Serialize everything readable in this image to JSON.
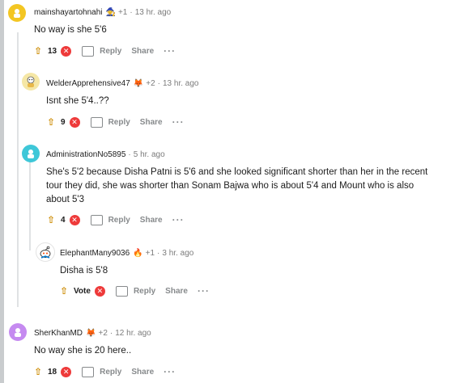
{
  "comments": [
    {
      "username": "mainshayartohnahi",
      "flair": "🧙",
      "badge": "+1",
      "time": "13 hr. ago",
      "text": "No way is she 5'6",
      "score": "13",
      "reply_label": "Reply",
      "share_label": "Share",
      "avatar_color": "#f3c623"
    },
    {
      "username": "WelderApprehensive47",
      "flair": "🦊",
      "badge": "+2",
      "time": "13 hr. ago",
      "text": "Isnt she 5'4..??",
      "score": "9",
      "reply_label": "Reply",
      "share_label": "Share",
      "avatar_color": "#f5e7a6"
    },
    {
      "username": "AdministrationNo5895",
      "flair": "",
      "badge": "",
      "time": "5 hr. ago",
      "text_lines": [
        "She's 5'2 because Disha Patni is 5'6 and she looked significant shorter than her in the recent",
        "tour they did, she was shorter than Sonam Bajwa who is about 5'4 and Mount who is also",
        "about 5'3"
      ],
      "score": "4",
      "reply_label": "Reply",
      "share_label": "Share",
      "avatar_color": "#3ec7d8"
    },
    {
      "username": "ElephantMany9036",
      "flair": "🔥",
      "badge": "+1",
      "time": "3 hr. ago",
      "text": "Disha is 5'8",
      "score": "Vote",
      "reply_label": "Reply",
      "share_label": "Share",
      "avatar_color": "#ffffff"
    },
    {
      "username": "SherKhanMD",
      "flair": "🦊",
      "badge": "+2",
      "time": "12 hr. ago",
      "text": "No way she is 20 here..",
      "score": "18",
      "reply_label": "Reply",
      "share_label": "Share",
      "avatar_color": "#c58af0"
    }
  ],
  "icons": {
    "upvote": "upvote-icon",
    "downvote": "downvote-icon",
    "reply": "reply-icon",
    "more": "more-icon"
  }
}
